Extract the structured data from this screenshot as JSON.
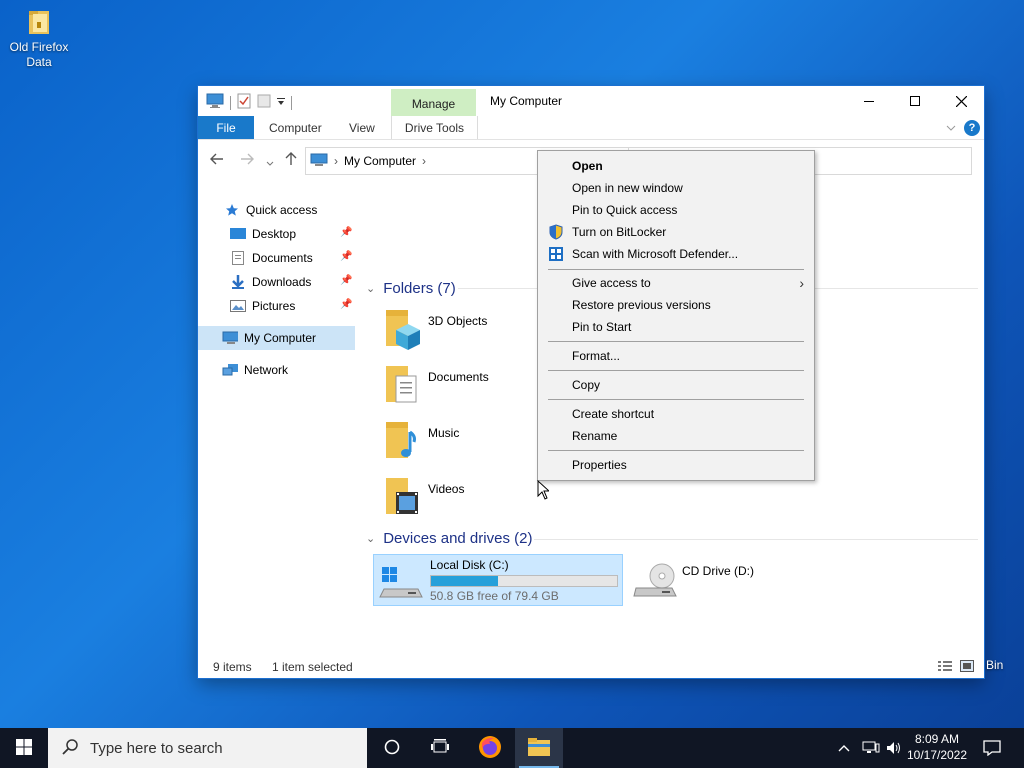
{
  "desktop": {
    "icon_label": "Old Firefox Data",
    "recycle_label": "Bin"
  },
  "window": {
    "title": "My Computer",
    "manage_tab": "Manage",
    "ribbon_tabs": {
      "file": "File",
      "computer": "Computer",
      "view": "View",
      "drive_tools": "Drive Tools"
    },
    "help": "?",
    "address": {
      "crumb": "My Computer"
    }
  },
  "nav": {
    "quick_access": "Quick access",
    "items": [
      {
        "label": "Desktop"
      },
      {
        "label": "Documents"
      },
      {
        "label": "Downloads"
      },
      {
        "label": "Pictures"
      }
    ],
    "my_computer": "My Computer",
    "network": "Network"
  },
  "content": {
    "folders_header": "Folders (7)",
    "folders": [
      {
        "label": "3D Objects"
      },
      {
        "label": "Documents"
      },
      {
        "label": "Music"
      },
      {
        "label": "Videos"
      }
    ],
    "drives_header": "Devices and drives (2)",
    "drives": [
      {
        "label": "Local Disk (C:)",
        "free": "50.8 GB free of 79.4 GB",
        "used_fraction": 0.36
      },
      {
        "label": "CD Drive (D:)"
      }
    ]
  },
  "status": {
    "items": "9 items",
    "selected": "1 item selected"
  },
  "context_menu": {
    "open": "Open",
    "open_new_window": "Open in new window",
    "pin_quick": "Pin to Quick access",
    "bitlocker": "Turn on BitLocker",
    "defender": "Scan with Microsoft Defender...",
    "give_access": "Give access to",
    "restore": "Restore previous versions",
    "pin_start": "Pin to Start",
    "format": "Format...",
    "copy": "Copy",
    "create_shortcut": "Create shortcut",
    "rename": "Rename",
    "properties": "Properties"
  },
  "taskbar": {
    "search_placeholder": "Type here to search",
    "time": "8:09 AM",
    "date": "10/17/2022"
  },
  "colors": {
    "accent": "#1979ca",
    "manage_tab": "#cfeec3",
    "selection": "#cce8ff",
    "drive_bar": "#26a0da"
  }
}
